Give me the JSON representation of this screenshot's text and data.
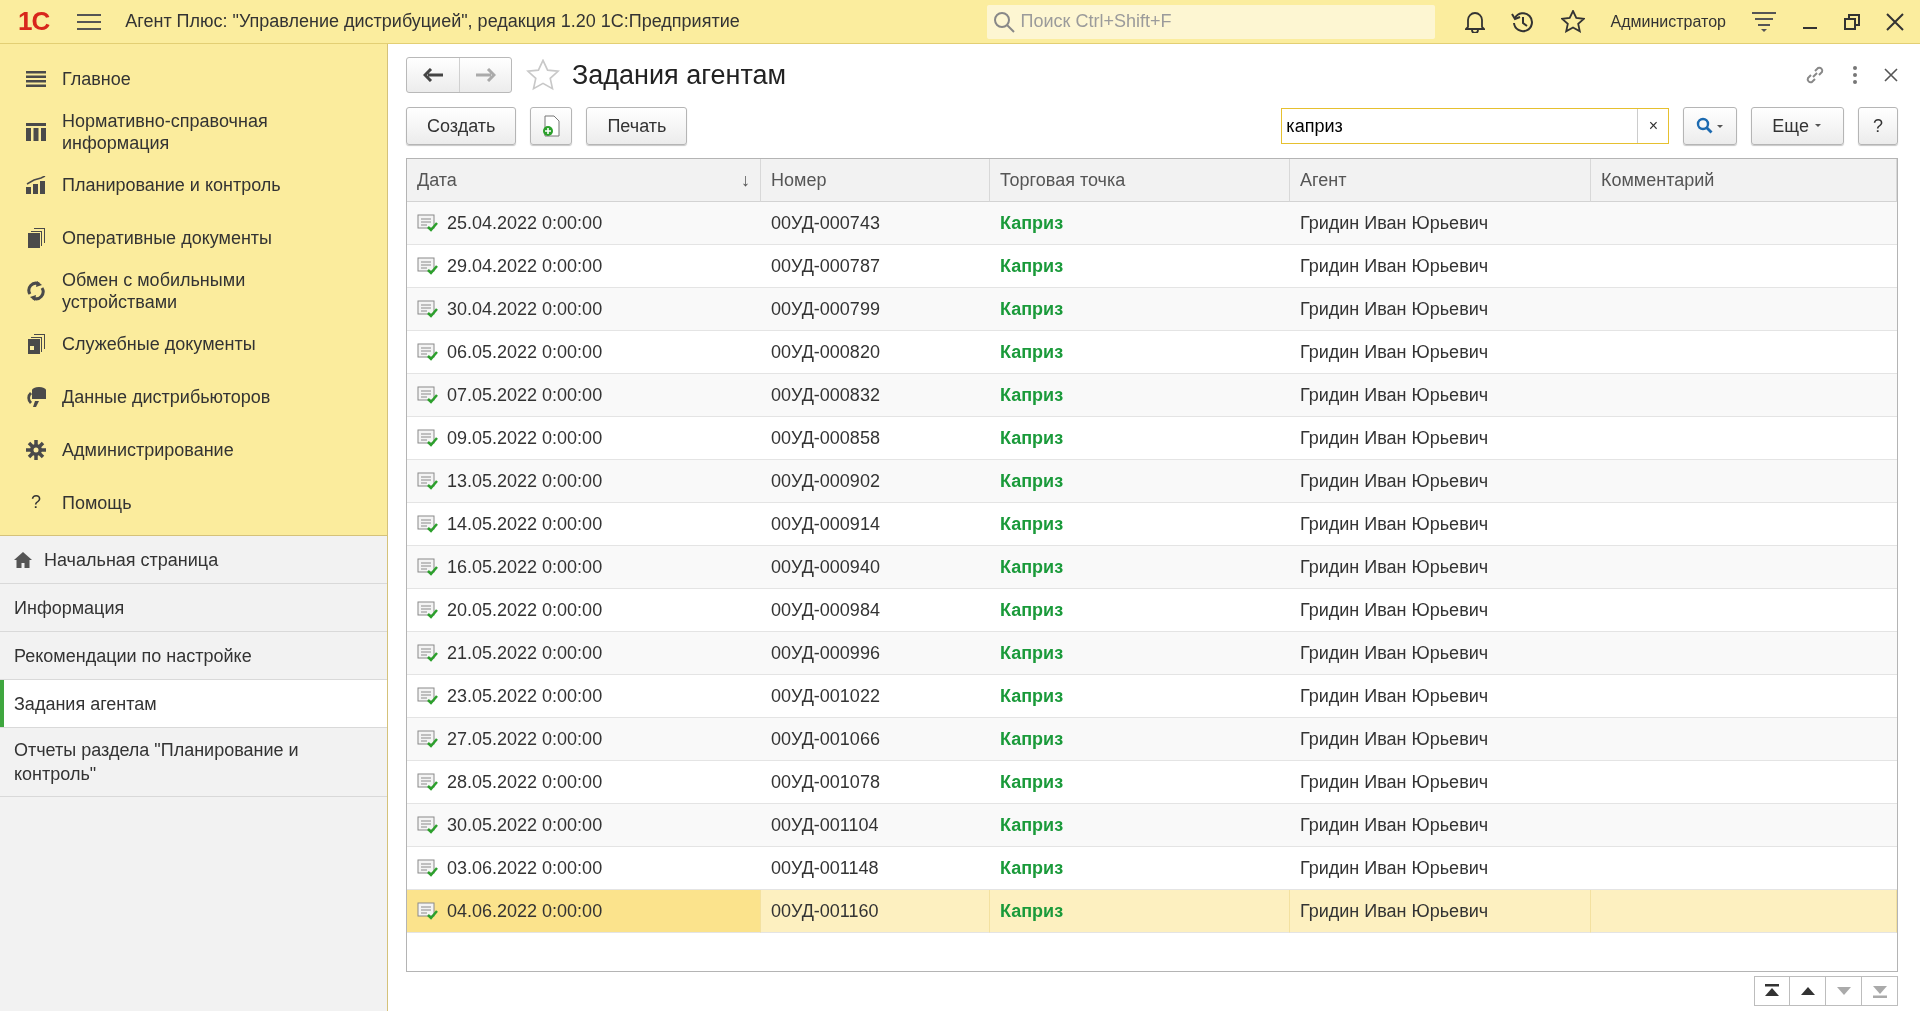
{
  "app_bar": {
    "logo": "1С",
    "title": "Агент Плюс: \"Управление дистрибуцией\", редакция 1.20 1С:Предприятие",
    "search_placeholder": "Поиск Ctrl+Shift+F",
    "user": "Администратор"
  },
  "sidebar": {
    "sections": [
      {
        "label": "Главное"
      },
      {
        "label": "Нормативно-справочная информация"
      },
      {
        "label": "Планирование и контроль"
      },
      {
        "label": "Оперативные документы"
      },
      {
        "label": "Обмен с мобильными устройствами"
      },
      {
        "label": "Служебные документы"
      },
      {
        "label": "Данные дистрибьюторов"
      },
      {
        "label": "Администрирование"
      },
      {
        "label": "Помощь",
        "glyph": "?"
      }
    ],
    "open_pages": [
      {
        "label": "Начальная страница",
        "kind": "home",
        "selected": false
      },
      {
        "label": "Информация",
        "kind": "page",
        "selected": false
      },
      {
        "label": "Рекомендации по настройке",
        "kind": "page",
        "selected": false
      },
      {
        "label": "Задания агентам",
        "kind": "page",
        "selected": true
      },
      {
        "label": "Отчеты раздела \"Планирование и контроль\"",
        "kind": "page",
        "selected": false
      }
    ]
  },
  "form": {
    "title": "Задания агентам",
    "back_disabled": false,
    "forward_disabled": true,
    "buttons": [
      "Создать",
      "Печать"
    ],
    "search_value": "каприз",
    "clear_mark": "×",
    "more_label": "Еще",
    "help_label": "?",
    "table": {
      "columns": [
        {
          "label": "Дата",
          "sort_mark": "↓"
        },
        {
          "label": "Номер"
        },
        {
          "label": "Торговая точка"
        },
        {
          "label": "Агент"
        },
        {
          "label": "Комментарий"
        }
      ],
      "rows": [
        {
          "date": "25.04.2022 0:00:00",
          "number": "00УД-000743",
          "outlet": "Каприз",
          "agent": "Гридин Иван Юрьевич",
          "selected": false
        },
        {
          "date": "29.04.2022 0:00:00",
          "number": "00УД-000787",
          "outlet": "Каприз",
          "agent": "Гридин Иван Юрьевич",
          "selected": false
        },
        {
          "date": "30.04.2022 0:00:00",
          "number": "00УД-000799",
          "outlet": "Каприз",
          "agent": "Гридин Иван Юрьевич",
          "selected": false
        },
        {
          "date": "06.05.2022 0:00:00",
          "number": "00УД-000820",
          "outlet": "Каприз",
          "agent": "Гридин Иван Юрьевич",
          "selected": false
        },
        {
          "date": "07.05.2022 0:00:00",
          "number": "00УД-000832",
          "outlet": "Каприз",
          "agent": "Гридин Иван Юрьевич",
          "selected": false
        },
        {
          "date": "09.05.2022 0:00:00",
          "number": "00УД-000858",
          "outlet": "Каприз",
          "agent": "Гридин Иван Юрьевич",
          "selected": false
        },
        {
          "date": "13.05.2022 0:00:00",
          "number": "00УД-000902",
          "outlet": "Каприз",
          "agent": "Гридин Иван Юрьевич",
          "selected": false
        },
        {
          "date": "14.05.2022 0:00:00",
          "number": "00УД-000914",
          "outlet": "Каприз",
          "agent": "Гридин Иван Юрьевич",
          "selected": false
        },
        {
          "date": "16.05.2022 0:00:00",
          "number": "00УД-000940",
          "outlet": "Каприз",
          "agent": "Гридин Иван Юрьевич",
          "selected": false
        },
        {
          "date": "20.05.2022 0:00:00",
          "number": "00УД-000984",
          "outlet": "Каприз",
          "agent": "Гридин Иван Юрьевич",
          "selected": false
        },
        {
          "date": "21.05.2022 0:00:00",
          "number": "00УД-000996",
          "outlet": "Каприз",
          "agent": "Гридин Иван Юрьевич",
          "selected": false
        },
        {
          "date": "23.05.2022 0:00:00",
          "number": "00УД-001022",
          "outlet": "Каприз",
          "agent": "Гридин Иван Юрьевич",
          "selected": false
        },
        {
          "date": "27.05.2022 0:00:00",
          "number": "00УД-001066",
          "outlet": "Каприз",
          "agent": "Гридин Иван Юрьевич",
          "selected": false
        },
        {
          "date": "28.05.2022 0:00:00",
          "number": "00УД-001078",
          "outlet": "Каприз",
          "agent": "Гридин Иван Юрьевич",
          "selected": false
        },
        {
          "date": "30.05.2022 0:00:00",
          "number": "00УД-001104",
          "outlet": "Каприз",
          "agent": "Гридин Иван Юрьевич",
          "selected": false
        },
        {
          "date": "03.06.2022 0:00:00",
          "number": "00УД-001148",
          "outlet": "Каприз",
          "agent": "Гридин Иван Юрьевич",
          "selected": false
        },
        {
          "date": "04.06.2022 0:00:00",
          "number": "00УД-001160",
          "outlet": "Каприз",
          "agent": "Гридин Иван Юрьевич",
          "selected": true
        }
      ]
    },
    "pager": [
      {
        "disabled": false
      },
      {
        "disabled": false
      },
      {
        "disabled": true
      },
      {
        "disabled": true
      }
    ]
  }
}
